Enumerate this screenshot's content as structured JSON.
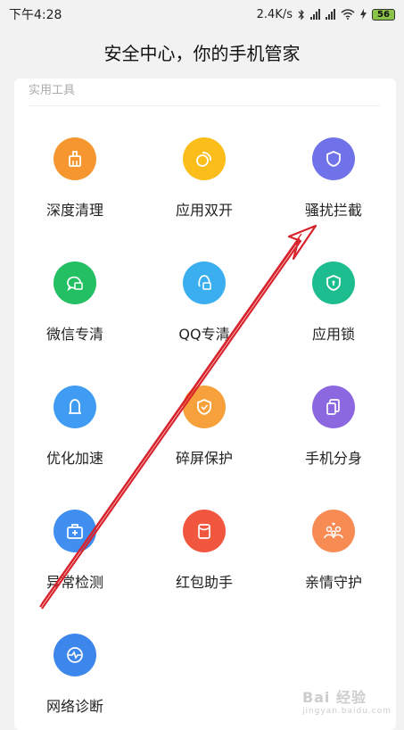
{
  "status_bar": {
    "time": "下午4:28",
    "speed": "2.4K/s",
    "battery": "56"
  },
  "header": {
    "title": "安全中心，你的手机管家"
  },
  "section": {
    "label": "实用工具"
  },
  "tools": [
    {
      "label": "深度清理",
      "icon": "clean-icon",
      "color": "#f5962e"
    },
    {
      "label": "应用双开",
      "icon": "dual-app-icon",
      "color": "#fbbd1a"
    },
    {
      "label": "骚扰拦截",
      "icon": "shield-icon",
      "color": "#6f72e8"
    },
    {
      "label": "微信专清",
      "icon": "wechat-clean-icon",
      "color": "#22c063"
    },
    {
      "label": "QQ专清",
      "icon": "qq-clean-icon",
      "color": "#3aaeef"
    },
    {
      "label": "应用锁",
      "icon": "app-lock-icon",
      "color": "#1ebd8f"
    },
    {
      "label": "优化加速",
      "icon": "boost-icon",
      "color": "#3f9cf2"
    },
    {
      "label": "碎屏保护",
      "icon": "screen-protect-icon",
      "color": "#f6a13b"
    },
    {
      "label": "手机分身",
      "icon": "phone-clone-icon",
      "color": "#8b67e0"
    },
    {
      "label": "异常检测",
      "icon": "anomaly-check-icon",
      "color": "#3f8ef0"
    },
    {
      "label": "红包助手",
      "icon": "red-packet-icon",
      "color": "#f0573e"
    },
    {
      "label": "亲情守护",
      "icon": "family-guard-icon",
      "color": "#f78b54"
    },
    {
      "label": "网络诊断",
      "icon": "network-diagnosis-icon",
      "color": "#3d86ec"
    }
  ],
  "watermark": {
    "text": "Bai 经验",
    "sub": "jingyan.baidu.com"
  },
  "annotation": {
    "arrow_color": "#d9232c"
  }
}
